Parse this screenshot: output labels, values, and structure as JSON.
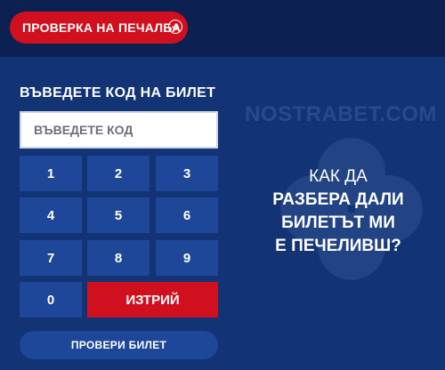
{
  "header": {
    "check_win_label": "ПРОВЕРКА НА ПЕЧАЛБА"
  },
  "watermark": "NOSTRABET.COM",
  "form": {
    "title": "ВЪВЕДЕТЕ КОД НА БИЛЕТ",
    "input_placeholder": "ВЪВЕДЕТЕ КОД",
    "input_value": "",
    "keys": [
      "1",
      "2",
      "3",
      "4",
      "5",
      "6",
      "7",
      "8",
      "9",
      "0"
    ],
    "delete_label": "ИЗТРИЙ",
    "check_ticket_label": "ПРОВЕРИ БИЛЕТ"
  },
  "info": {
    "line1": "КАК ДА",
    "line2": "РАЗБЕРА ДАЛИ",
    "line3": "БИЛЕТЪТ МИ",
    "line4": "Е ПЕЧЕЛИВШ?"
  },
  "colors": {
    "header_bg": "#0c2152",
    "main_bg": "#123374",
    "key_bg": "#1e4799",
    "accent_red": "#d0101e",
    "text": "#ffffff"
  },
  "icons": {
    "check_win_arrow": "arrow-right-circle-icon",
    "background": "clover-icon"
  }
}
